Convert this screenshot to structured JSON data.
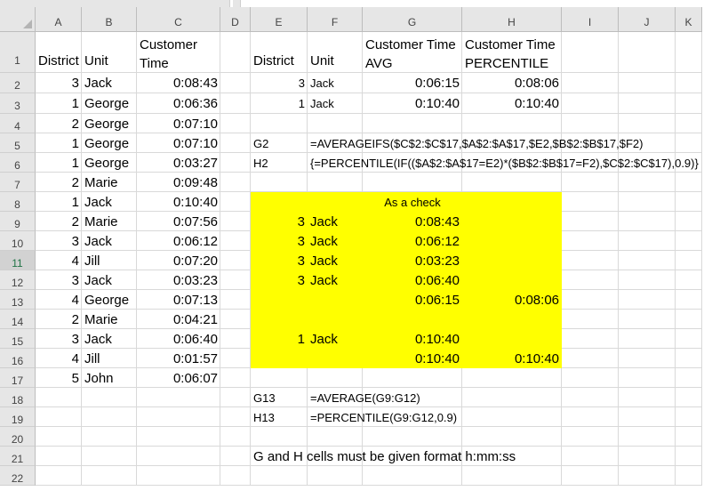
{
  "columns": [
    "A",
    "B",
    "C",
    "D",
    "E",
    "F",
    "G",
    "H",
    "I",
    "J",
    "K"
  ],
  "rows": [
    "1",
    "2",
    "3",
    "4",
    "5",
    "6",
    "7",
    "8",
    "9",
    "10",
    "11",
    "12",
    "13",
    "14",
    "15",
    "16",
    "17",
    "18",
    "19",
    "20",
    "21",
    "22"
  ],
  "selected_row": "11",
  "cells": {
    "A1": "District",
    "B1": "Unit",
    "C1a": "Customer",
    "C1b": "Time",
    "E1": "District",
    "F1": "Unit",
    "G1a": "Customer Time",
    "G1b": "AVG",
    "H1a": "Customer Time",
    "H1b": "PERCENTILE",
    "A2": "3",
    "B2": "Jack",
    "C2": "0:08:43",
    "A3": "1",
    "B3": "George",
    "C3": "0:06:36",
    "A4": "2",
    "B4": "George",
    "C4": "0:07:10",
    "A5": "1",
    "B5": "George",
    "C5": "0:07:10",
    "A6": "1",
    "B6": "George",
    "C6": "0:03:27",
    "A7": "2",
    "B7": "Marie",
    "C7": "0:09:48",
    "A8": "1",
    "B8": "Jack",
    "C8": "0:10:40",
    "A9": "2",
    "B9": "Marie",
    "C9": "0:07:56",
    "A10": "3",
    "B10": "Jack",
    "C10": "0:06:12",
    "A11": "4",
    "B11": "Jill",
    "C11": "0:07:20",
    "A12": "3",
    "B12": "Jack",
    "C12": "0:03:23",
    "A13": "4",
    "B13": "George",
    "C13": "0:07:13",
    "A14": "2",
    "B14": "Marie",
    "C14": "0:04:21",
    "A15": "3",
    "B15": "Jack",
    "C15": "0:06:40",
    "A16": "4",
    "B16": "Jill",
    "C16": "0:01:57",
    "A17": "5",
    "B17": "John",
    "C17": "0:06:07",
    "E2": "3",
    "F2": "Jack",
    "G2": "0:06:15",
    "H2": "0:08:06",
    "E3": "1",
    "F3": "Jack",
    "G3": "0:10:40",
    "H3": "0:10:40",
    "E5": "G2",
    "F5": "=AVERAGEIFS($C$2:$C$17,$A$2:$A$17,$E2,$B$2:$B$17,$F2)",
    "E6": "H2",
    "F6": "{=PERCENTILE(IF(($A$2:$A$17=E2)*($B$2:$B$17=F2),$C$2:$C$17),0.9)}",
    "G8": "As a check",
    "E9": "3",
    "F9": "Jack",
    "G9": "0:08:43",
    "E10": "3",
    "F10": "Jack",
    "G10": "0:06:12",
    "E11": "3",
    "F11": "Jack",
    "G11": "0:03:23",
    "E12": "3",
    "F12": "Jack",
    "G12": "0:06:40",
    "G13": "0:06:15",
    "H13": "0:08:06",
    "E15": "1",
    "F15": "Jack",
    "G15": "0:10:40",
    "G16": "0:10:40",
    "H16": "0:10:40",
    "E18": "G13",
    "F18": "=AVERAGE(G9:G12)",
    "E19": "H13",
    "F19": "=PERCENTILE(G9:G12,0.9)",
    "E21": "G and H cells must be given format h:mm:ss"
  },
  "colors": {
    "highlight": "#ffff00",
    "header_bg": "#e6e6e6",
    "gridline": "#d9d9d9",
    "selected_row_text": "#217346"
  }
}
